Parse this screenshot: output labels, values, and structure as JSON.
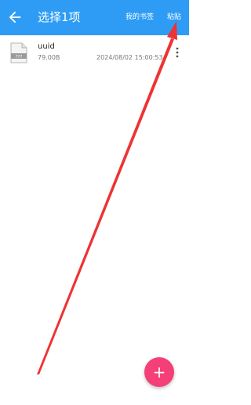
{
  "appbar": {
    "title": "选择1项",
    "bookmarks_label": "我的书签",
    "paste_label": "粘贴",
    "background_color": "#2e9cf5"
  },
  "files": [
    {
      "name": "uuid",
      "size": "79.00B",
      "modified": "2024/08/02 15:00:53",
      "icon_label": "???"
    }
  ],
  "fab": {
    "symbol": "+",
    "color": "#f43f78"
  },
  "annotation": {
    "color": "#ee3333"
  }
}
